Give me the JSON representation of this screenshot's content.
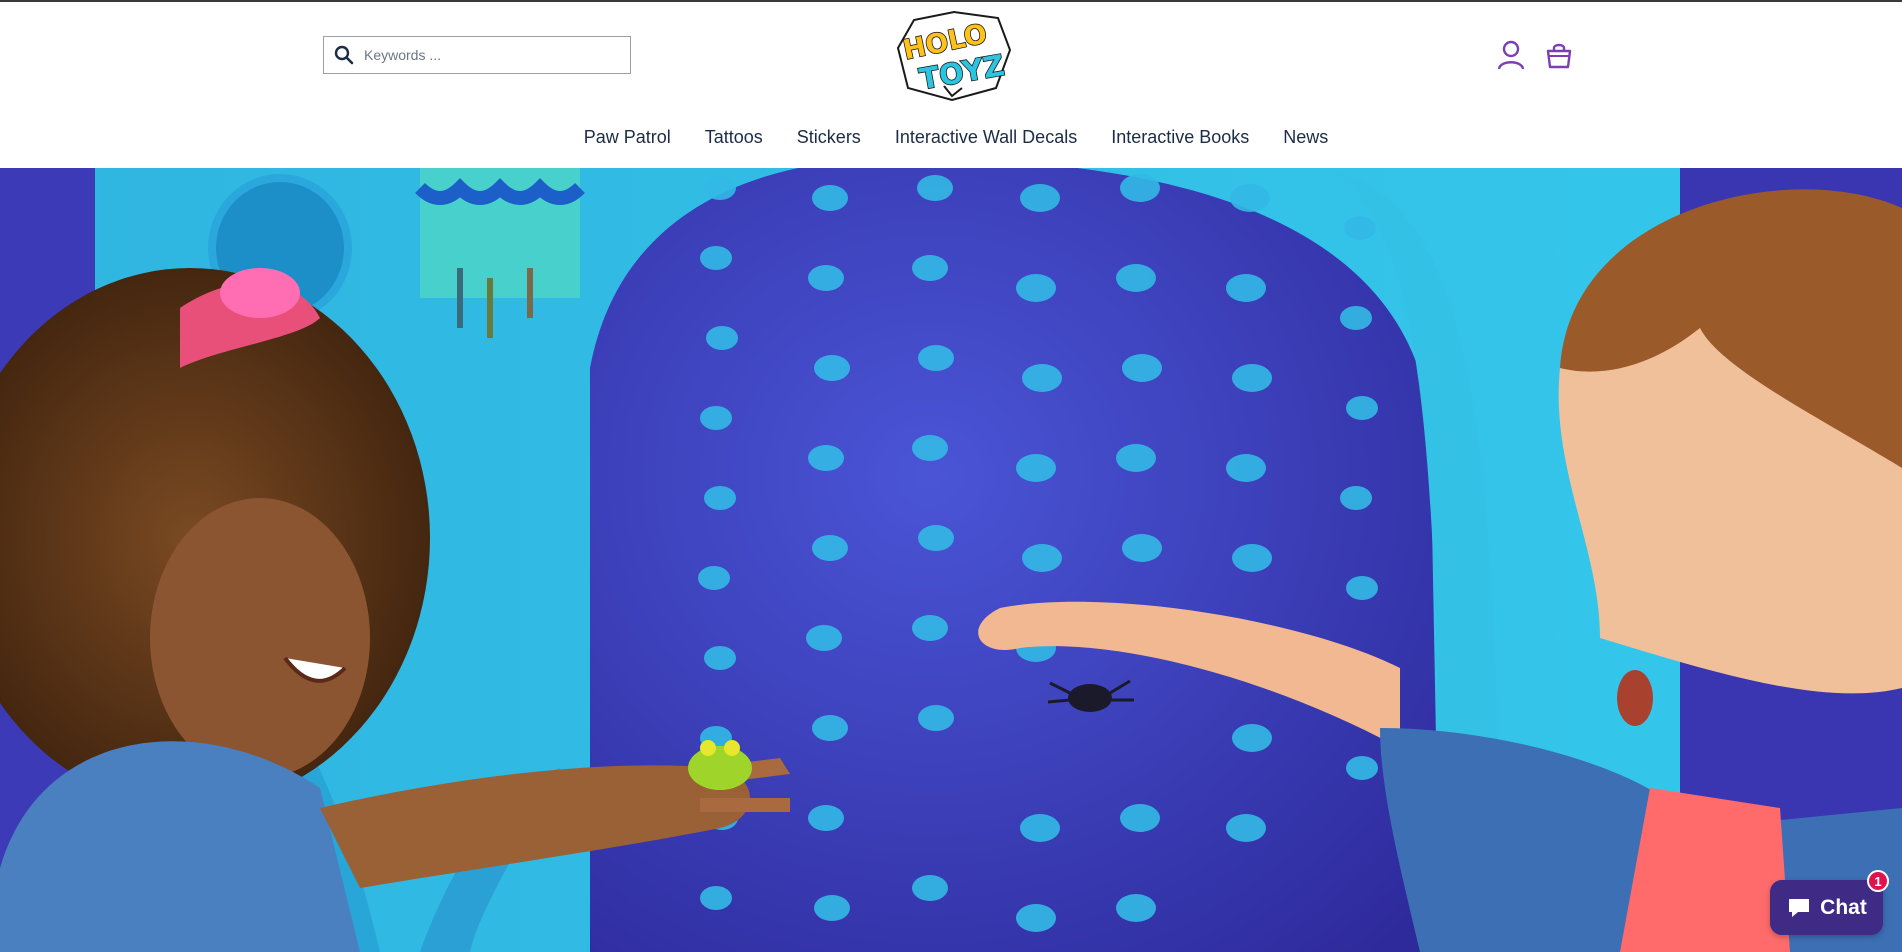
{
  "header": {
    "search": {
      "placeholder": "Keywords ..."
    },
    "logo": {
      "line1": "HOLO",
      "line2": "TOYZ"
    },
    "icons": {
      "account": "user-icon",
      "cart": "shopping-bag-icon"
    }
  },
  "nav": {
    "items": [
      {
        "label": "Paw Patrol"
      },
      {
        "label": "Tattoos"
      },
      {
        "label": "Stickers"
      },
      {
        "label": "Interactive Wall Decals"
      },
      {
        "label": "Interactive Books"
      },
      {
        "label": "News"
      }
    ]
  },
  "hero": {
    "image": "kids-with-ar-frog-and-spider"
  },
  "chat": {
    "label": "Chat",
    "badge": "1"
  },
  "colors": {
    "accent": "#7b3fb4",
    "nav_text": "#1c2b46",
    "chat_bg": "#3f2b86",
    "badge": "#e0134f"
  }
}
